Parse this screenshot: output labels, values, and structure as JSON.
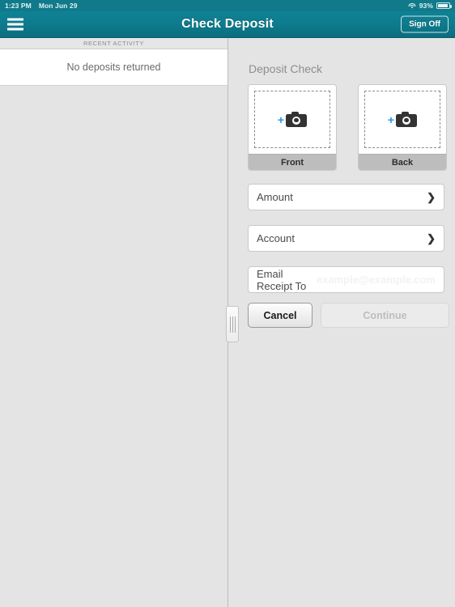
{
  "status_bar": {
    "time": "1:23 PM",
    "date": "Mon Jun 29",
    "wifi_icon": "wifi-icon",
    "battery_percent": "93%",
    "battery_icon": "battery-icon"
  },
  "nav": {
    "menu_icon": "hamburger-menu-icon",
    "title": "Check Deposit",
    "sign_off_label": "Sign Off"
  },
  "left_panel": {
    "section_header": "RECENT ACTIVITY",
    "empty_message": "No deposits returned"
  },
  "right_panel": {
    "section_title": "Deposit Check",
    "capture_cards": [
      {
        "label": "Front",
        "plus_icon": "plus-icon",
        "camera_icon": "camera-icon"
      },
      {
        "label": "Back",
        "plus_icon": "plus-icon",
        "camera_icon": "camera-icon"
      }
    ],
    "fields": [
      {
        "label": "Amount",
        "value": "",
        "chevron_icon": "chevron-right-icon"
      },
      {
        "label": "Account",
        "value": "",
        "chevron_icon": "chevron-right-icon"
      }
    ],
    "email_field": {
      "label": "Email Receipt To",
      "value": "",
      "placeholder": "example@example.com"
    },
    "buttons": {
      "cancel_label": "Cancel",
      "continue_label": "Continue"
    },
    "splitter_icon": "drag-handle-icon"
  },
  "colors": {
    "nav_teal": "#0e7c8e",
    "status_teal": "#107a8b",
    "accent_blue": "#2196f3",
    "panel_gray": "#e4e4e4",
    "card_label_gray": "#bdbdbd"
  }
}
